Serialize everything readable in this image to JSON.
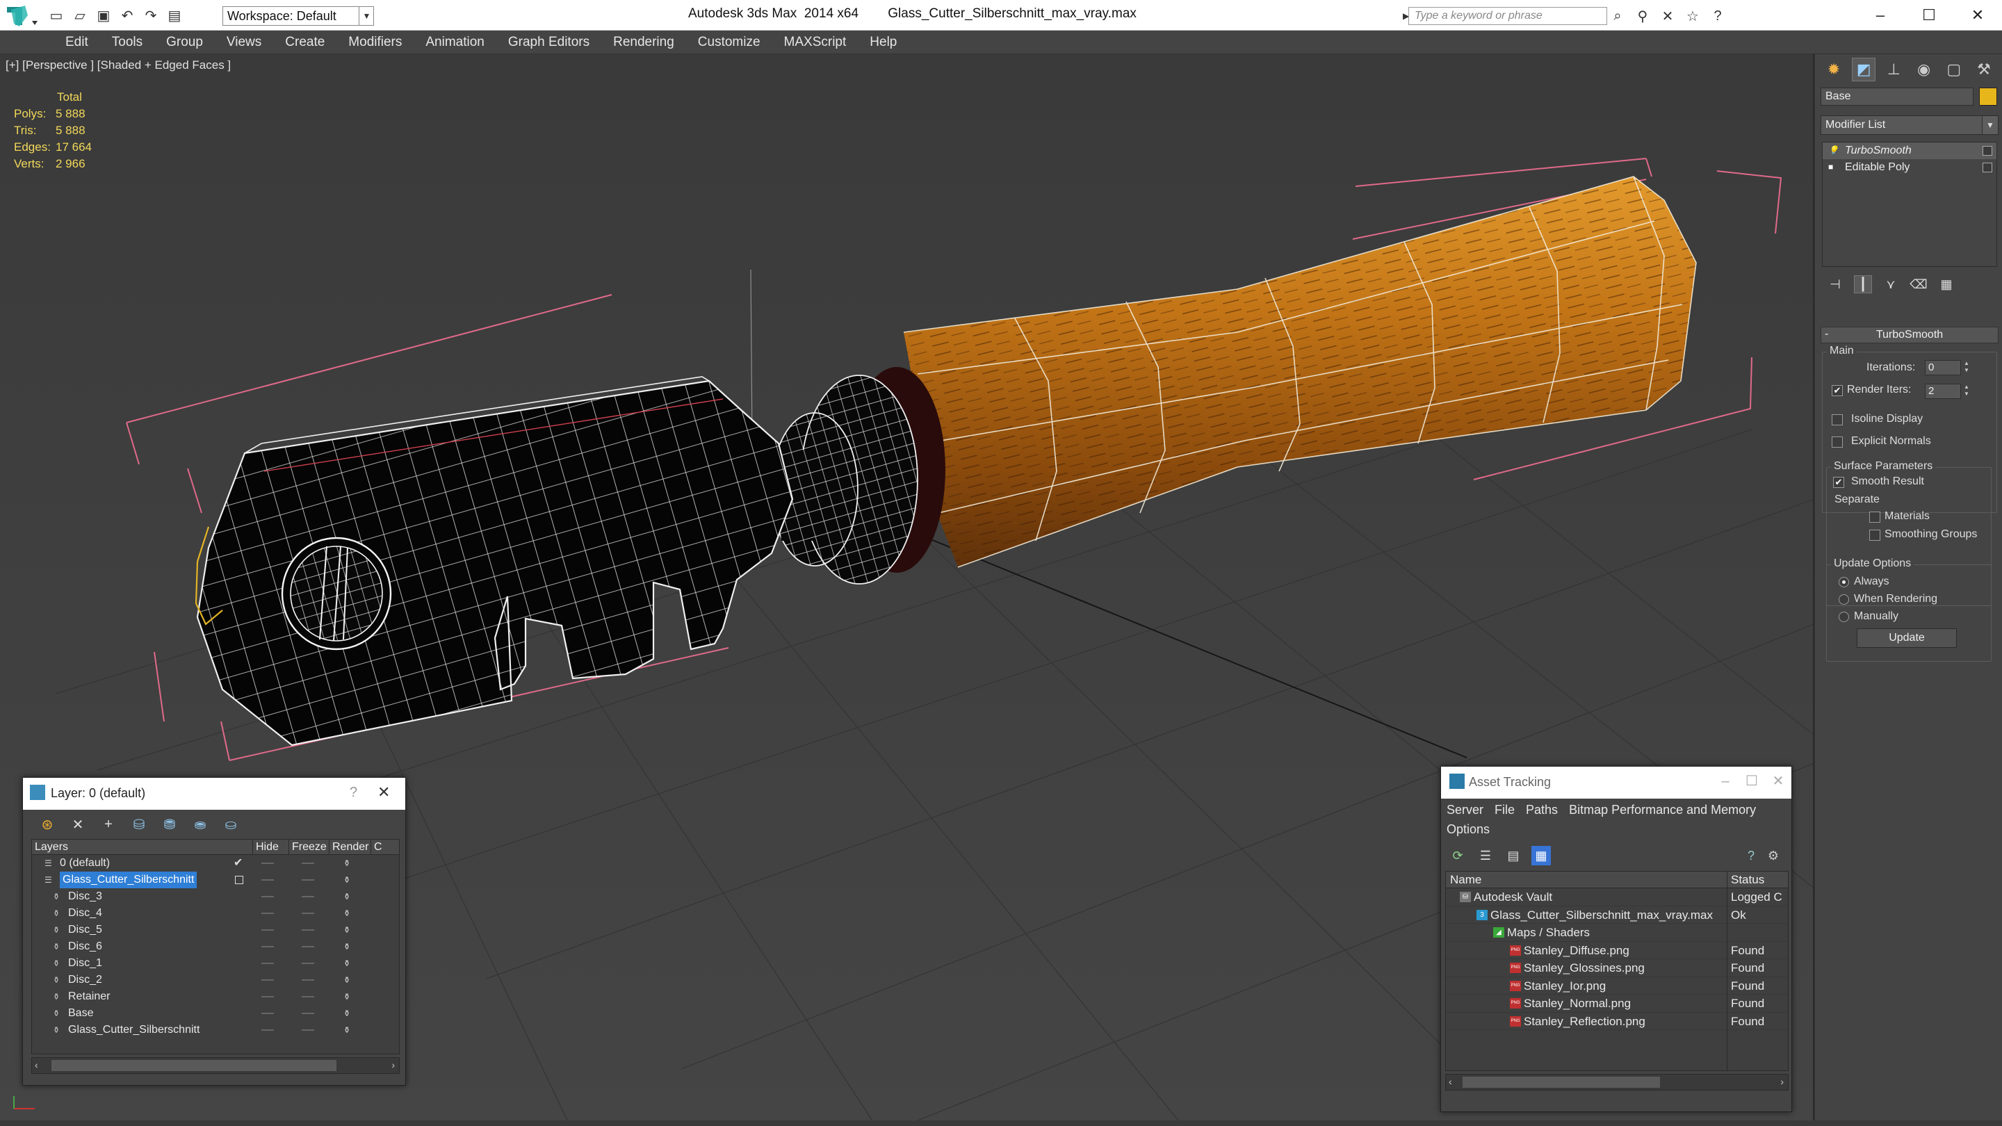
{
  "window": {
    "app_name": "Autodesk 3ds Max  2014 x64",
    "file_name": "Glass_Cutter_Silberschnitt_max_vray.max"
  },
  "toolbar": {
    "workspace": "Workspace: Default",
    "search_placeholder": "Type a keyword or phrase"
  },
  "menu": [
    "Edit",
    "Tools",
    "Group",
    "Views",
    "Create",
    "Modifiers",
    "Animation",
    "Graph Editors",
    "Rendering",
    "Customize",
    "MAXScript",
    "Help"
  ],
  "viewport": {
    "label": "[+] [Perspective ] [Shaded + Edged Faces ]",
    "stats": {
      "total_label": "Total",
      "rows": [
        {
          "key": "Polys:",
          "value": "5 888"
        },
        {
          "key": "Tris:",
          "value": "5 888"
        },
        {
          "key": "Edges:",
          "value": "17 664"
        },
        {
          "key": "Verts:",
          "value": "2 966"
        }
      ]
    }
  },
  "command_panel": {
    "object_name": "Base",
    "object_color": "#e7b61b",
    "modifier_list": "Modifier List",
    "stack": [
      {
        "label": "TurboSmooth",
        "selected": true
      },
      {
        "label": "Editable Poly",
        "selected": false
      }
    ],
    "rollout_title": "TurboSmooth",
    "main_group": "Main",
    "iterations_label": "Iterations:",
    "iterations_value": "0",
    "render_iters_label": "Render Iters:",
    "render_iters_value": "2",
    "render_iters_checked": true,
    "isoline_label": "Isoline Display",
    "explicit_normals_label": "Explicit Normals",
    "surface_group": "Surface Parameters",
    "smooth_result_label": "Smooth Result",
    "separate_label": "Separate",
    "materials_label": "Materials",
    "smoothing_groups_label": "Smoothing Groups",
    "update_group": "Update Options",
    "always_label": "Always",
    "when_rendering_label": "When Rendering",
    "manually_label": "Manually",
    "update_button": "Update"
  },
  "layer_window": {
    "title": "Layer: 0 (default)",
    "help": "?",
    "columns": [
      "Layers",
      "Hide",
      "Freeze",
      "Render",
      "C"
    ],
    "rows": [
      {
        "name": "0 (default)",
        "level": 0,
        "current": true,
        "selected": false
      },
      {
        "name": "Glass_Cutter_Silberschnitt",
        "level": 0,
        "current": false,
        "selected": true
      },
      {
        "name": "Disc_3",
        "level": 1,
        "current": false,
        "selected": false
      },
      {
        "name": "Disc_4",
        "level": 1,
        "current": false,
        "selected": false
      },
      {
        "name": "Disc_5",
        "level": 1,
        "current": false,
        "selected": false
      },
      {
        "name": "Disc_6",
        "level": 1,
        "current": false,
        "selected": false
      },
      {
        "name": "Disc_1",
        "level": 1,
        "current": false,
        "selected": false
      },
      {
        "name": "Disc_2",
        "level": 1,
        "current": false,
        "selected": false
      },
      {
        "name": "Retainer",
        "level": 1,
        "current": false,
        "selected": false
      },
      {
        "name": "Base",
        "level": 1,
        "current": false,
        "selected": false
      },
      {
        "name": "Glass_Cutter_Silberschnitt",
        "level": 1,
        "current": false,
        "selected": false
      }
    ]
  },
  "asset_window": {
    "title": "Asset Tracking",
    "menu": [
      "Server",
      "File",
      "Paths",
      "Bitmap Performance and Memory",
      "Options"
    ],
    "columns": [
      "Name",
      "Status"
    ],
    "rows": [
      {
        "name": "Autodesk Vault",
        "status": "Logged C",
        "level": 0,
        "icon": "vault"
      },
      {
        "name": "Glass_Cutter_Silberschnitt_max_vray.max",
        "status": "Ok",
        "level": 1,
        "icon": "max"
      },
      {
        "name": "Maps / Shaders",
        "status": "",
        "level": 2,
        "icon": "maps"
      },
      {
        "name": "Stanley_Diffuse.png",
        "status": "Found",
        "level": 3,
        "icon": "png"
      },
      {
        "name": "Stanley_Glossines.png",
        "status": "Found",
        "level": 3,
        "icon": "png"
      },
      {
        "name": "Stanley_Ior.png",
        "status": "Found",
        "level": 3,
        "icon": "png"
      },
      {
        "name": "Stanley_Normal.png",
        "status": "Found",
        "level": 3,
        "icon": "png"
      },
      {
        "name": "Stanley_Reflection.png",
        "status": "Found",
        "level": 3,
        "icon": "png"
      }
    ]
  }
}
